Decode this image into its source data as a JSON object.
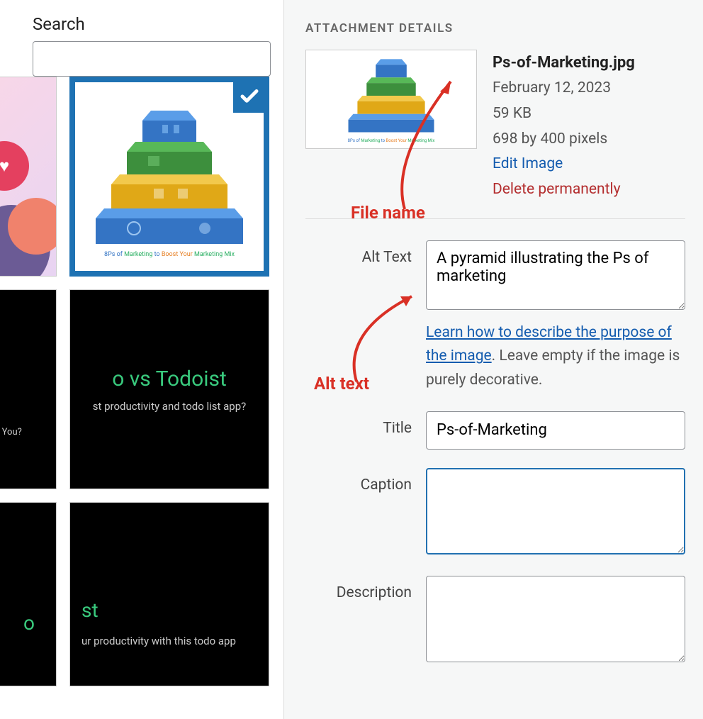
{
  "search": {
    "label": "Search",
    "value": ""
  },
  "thumbnails": {
    "selected_caption_parts": {
      "pre": "8Ps of",
      "mid": "Marketing",
      "sep": " to ",
      "boost": "Boost Your",
      "tail": "Marketing Mix"
    },
    "black1_title": "o vs Todoist",
    "black1_sub": "st productivity and todo list app?",
    "black1_left_sub": "r You?",
    "black2_title_a": "o",
    "black2_title_b": "st",
    "black2_sub": "ur productivity with this todo app"
  },
  "details": {
    "heading": "ATTACHMENT DETAILS",
    "filename": "Ps-of-Marketing.jpg",
    "date": "February 12, 2023",
    "size": "59 KB",
    "dimensions": "698 by 400 pixels",
    "edit_link": "Edit Image",
    "delete_link": "Delete permanently"
  },
  "fields": {
    "alt_label": "Alt Text",
    "alt_value": "A pyramid illustrating the Ps of marketing",
    "alt_help_link": "Learn how to describe the purpose of the image",
    "alt_help_tail": ". Leave empty if the image is purely decorative.",
    "title_label": "Title",
    "title_value": "Ps-of-Marketing",
    "caption_label": "Caption",
    "caption_value": "",
    "description_label": "Description",
    "description_value": ""
  },
  "annotations": {
    "filename": "File name",
    "alt": "Alt text"
  }
}
